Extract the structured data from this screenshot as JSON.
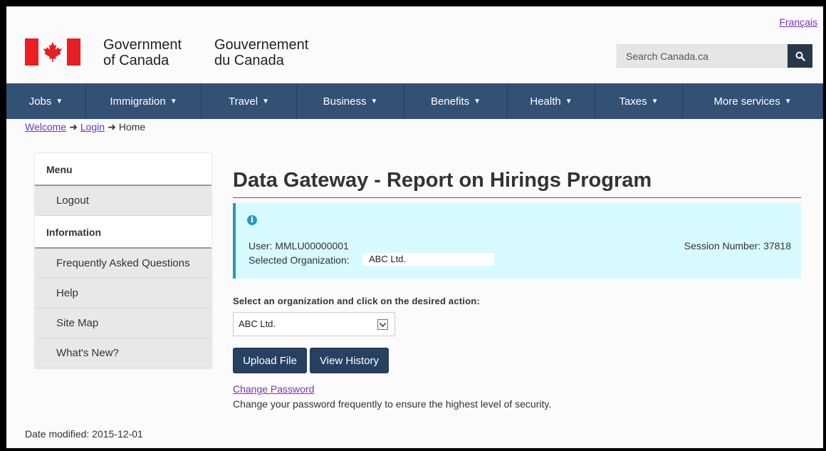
{
  "header": {
    "language_link": "Français",
    "signature_en_line1": "Government",
    "signature_en_line2": "of Canada",
    "signature_fr_line1": "Gouvernement",
    "signature_fr_line2": "du Canada",
    "search_placeholder": "Search Canada.ca",
    "search_icon": "search-icon"
  },
  "nav": {
    "items": [
      {
        "label": "Jobs"
      },
      {
        "label": "Immigration"
      },
      {
        "label": "Travel"
      },
      {
        "label": "Business"
      },
      {
        "label": "Benefits"
      },
      {
        "label": "Health"
      },
      {
        "label": "Taxes"
      },
      {
        "label": "More services"
      }
    ],
    "chevron": "⌄"
  },
  "breadcrumb": {
    "items": [
      "Welcome",
      "Login",
      "Home"
    ],
    "separator": "➜"
  },
  "sidebar": {
    "menu_header": "Menu",
    "menu_items": [
      "Logout"
    ],
    "info_header": "Information",
    "info_items": [
      "Frequently Asked Questions",
      "Help",
      "Site Map",
      "What's New?"
    ]
  },
  "main": {
    "title": "Data Gateway - Report on Hirings Program",
    "alert": {
      "info_icon": "i",
      "user": "User: MMLU00000001",
      "organization_label": "Selected Organization:",
      "organization_value": "ABC Ltd.",
      "session": "Session Number: 37818"
    },
    "select_label": "Select an organization and click on the desired action:",
    "select_value": "ABC Ltd.",
    "buttons": {
      "upload": "Upload File",
      "history": "View History"
    },
    "change_password_link": "Change Password",
    "change_password_desc": "Change your password frequently to ensure the highest level of security."
  },
  "footer": {
    "date_modified": "Date modified: 2015-12-01"
  },
  "colors": {
    "nav_bg": "#335075",
    "button_bg": "#284162",
    "link": "#7834bc",
    "alert_bg": "#d7faff",
    "flag_red": "#ea1c24",
    "title_rule": "#af3c43"
  }
}
